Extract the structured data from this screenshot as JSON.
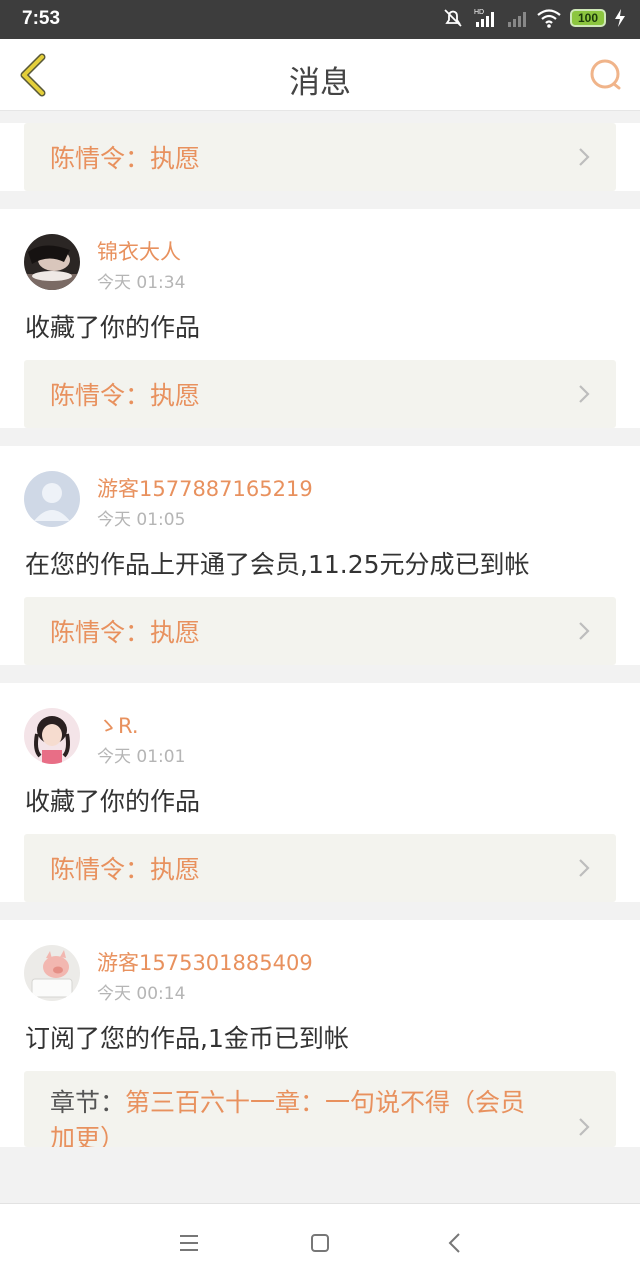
{
  "status": {
    "time": "7:53",
    "battery": "100"
  },
  "header": {
    "title": "消息"
  },
  "first_work": "陈情令：执愿",
  "messages": [
    {
      "user": "锦衣大人",
      "time": "今天 01:34",
      "text": "收藏了你的作品",
      "work": "陈情令：执愿",
      "avatar_icon": "photo-avatar-dark"
    },
    {
      "user": "游客1577887165219",
      "time": "今天 01:05",
      "text": "在您的作品上开通了会员,11.25元分成已到帐",
      "work": "陈情令：执愿",
      "avatar_icon": "default-user-avatar"
    },
    {
      "user": "ゝR.",
      "time": "今天 01:01",
      "text": "收藏了你的作品",
      "work": "陈情令：执愿",
      "avatar_icon": "photo-avatar-girl"
    },
    {
      "user": "游客1575301885409",
      "time": "今天 00:14",
      "text": "订阅了您的作品,1金币已到帐",
      "chapter_prefix": "章节：",
      "chapter": "第三百六十一章：一句说不得（会员加更）",
      "avatar_icon": "photo-avatar-pig"
    }
  ],
  "colors": {
    "accent": "#e8915e",
    "back_icon": "#e4cf3a",
    "search_icon": "#f0b48a"
  }
}
